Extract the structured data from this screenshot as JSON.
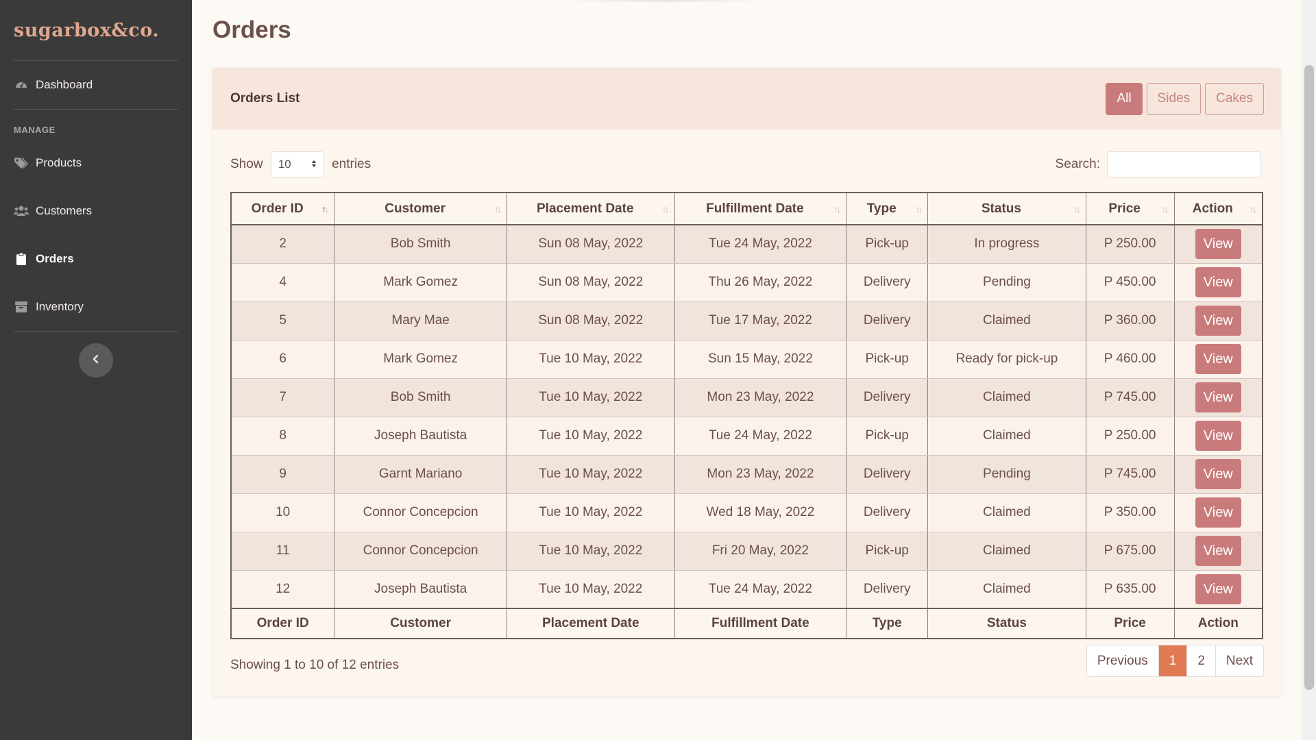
{
  "sidebar": {
    "brand": "sugarbox&co.",
    "items_top": [
      {
        "label": "Dashboard",
        "icon": "dashboard-gauge-icon"
      }
    ],
    "section_title": "MANAGE",
    "items": [
      {
        "label": "Products",
        "icon": "tags-icon"
      },
      {
        "label": "Customers",
        "icon": "users-icon"
      },
      {
        "label": "Orders",
        "icon": "clipboard-icon",
        "active": true
      },
      {
        "label": "Inventory",
        "icon": "archive-box-icon"
      }
    ],
    "collapse_icon": "chevron-left-icon"
  },
  "page": {
    "title": "Orders"
  },
  "card": {
    "title": "Orders List",
    "filters": [
      "All",
      "Sides",
      "Cakes"
    ],
    "active_filter": "All"
  },
  "controls": {
    "show_label": "Show",
    "entries_value": "10",
    "entries_label": "entries",
    "search_label": "Search:",
    "search_value": ""
  },
  "table": {
    "columns": [
      "Order ID",
      "Customer",
      "Placement Date",
      "Fulfillment Date",
      "Type",
      "Status",
      "Price",
      "Action"
    ],
    "sorted_column": "Order ID",
    "rows": [
      {
        "id": "2",
        "customer": "Bob Smith",
        "placed": "Sun 08 May, 2022",
        "fulfilled": "Tue 24 May, 2022",
        "type": "Pick-up",
        "status": "In progress",
        "price": "P 250.00",
        "action": "View"
      },
      {
        "id": "4",
        "customer": "Mark Gomez",
        "placed": "Sun 08 May, 2022",
        "fulfilled": "Thu 26 May, 2022",
        "type": "Delivery",
        "status": "Pending",
        "price": "P 450.00",
        "action": "View"
      },
      {
        "id": "5",
        "customer": "Mary Mae",
        "placed": "Sun 08 May, 2022",
        "fulfilled": "Tue 17 May, 2022",
        "type": "Delivery",
        "status": "Claimed",
        "price": "P 360.00",
        "action": "View"
      },
      {
        "id": "6",
        "customer": "Mark Gomez",
        "placed": "Tue 10 May, 2022",
        "fulfilled": "Sun 15 May, 2022",
        "type": "Pick-up",
        "status": "Ready for pick-up",
        "price": "P 460.00",
        "action": "View"
      },
      {
        "id": "7",
        "customer": "Bob Smith",
        "placed": "Tue 10 May, 2022",
        "fulfilled": "Mon 23 May, 2022",
        "type": "Delivery",
        "status": "Claimed",
        "price": "P 745.00",
        "action": "View"
      },
      {
        "id": "8",
        "customer": "Joseph Bautista",
        "placed": "Tue 10 May, 2022",
        "fulfilled": "Tue 24 May, 2022",
        "type": "Pick-up",
        "status": "Claimed",
        "price": "P 250.00",
        "action": "View"
      },
      {
        "id": "9",
        "customer": "Garnt Mariano",
        "placed": "Tue 10 May, 2022",
        "fulfilled": "Mon 23 May, 2022",
        "type": "Delivery",
        "status": "Pending",
        "price": "P 745.00",
        "action": "View"
      },
      {
        "id": "10",
        "customer": "Connor Concepcion",
        "placed": "Tue 10 May, 2022",
        "fulfilled": "Wed 18 May, 2022",
        "type": "Delivery",
        "status": "Claimed",
        "price": "P 350.00",
        "action": "View"
      },
      {
        "id": "11",
        "customer": "Connor Concepcion",
        "placed": "Tue 10 May, 2022",
        "fulfilled": "Fri 20 May, 2022",
        "type": "Pick-up",
        "status": "Claimed",
        "price": "P 675.00",
        "action": "View"
      },
      {
        "id": "12",
        "customer": "Joseph Bautista",
        "placed": "Tue 10 May, 2022",
        "fulfilled": "Tue 24 May, 2022",
        "type": "Delivery",
        "status": "Claimed",
        "price": "P 635.00",
        "action": "View"
      }
    ]
  },
  "footer": {
    "info": "Showing 1 to 10 of 12 entries",
    "pagination": {
      "previous": "Previous",
      "pages": [
        "1",
        "2"
      ],
      "current": "1",
      "next": "Next"
    }
  },
  "colors": {
    "sidebar_bg": "#3a3a3a",
    "accent": "#c97b7b",
    "current_page": "#e07a55",
    "page_bg": "#fdf9f4"
  }
}
